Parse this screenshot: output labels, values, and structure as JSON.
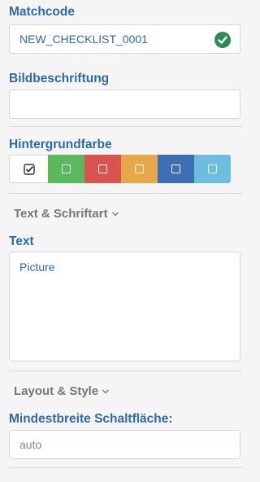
{
  "matchcode": {
    "label": "Matchcode",
    "value": "NEW_CHECKLIST_0001",
    "valid_icon": "check-circle-icon",
    "valid_color": "#2e8b57"
  },
  "caption": {
    "label": "Bildbeschriftung",
    "value": ""
  },
  "background": {
    "label": "Hintergrundfarbe",
    "swatches": [
      {
        "name": "white",
        "color": "#ffffff",
        "selected": true
      },
      {
        "name": "green",
        "color": "#5cb85c",
        "selected": false
      },
      {
        "name": "red",
        "color": "#d9534f",
        "selected": false
      },
      {
        "name": "orange",
        "color": "#e8a84a",
        "selected": false
      },
      {
        "name": "blue",
        "color": "#3e6fb5",
        "selected": false
      },
      {
        "name": "lightblue",
        "color": "#6cbde0",
        "selected": false
      }
    ]
  },
  "text_font_section": {
    "label": "Text & Schriftart",
    "icon": "chevron-down-icon"
  },
  "text": {
    "label": "Text",
    "value": "Picture"
  },
  "layout_style_section": {
    "label": "Layout & Style",
    "icon": "chevron-down-icon"
  },
  "min_width": {
    "label": "Mindestbreite Schaltfläche:",
    "value": "auto"
  },
  "colors": {
    "accent": "#2d6aa8",
    "section": "#777777"
  }
}
